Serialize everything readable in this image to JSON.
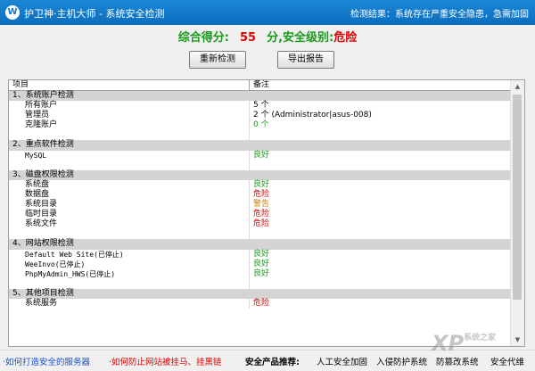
{
  "window": {
    "title": "护卫神·主机大师 - 系统安全检测",
    "logo_glyph": "W",
    "status": "检测结果：系统存在严重安全隐患，急需加固"
  },
  "score": {
    "label": "综合得分:",
    "value": "55",
    "unit": "分,",
    "level_label": "安全级别:",
    "level": "危险"
  },
  "buttons": {
    "recheck": "重新检测",
    "export": "导出报告"
  },
  "table": {
    "headers": [
      "项目",
      "备注"
    ],
    "groups": [
      {
        "title": "1、系统账户检测",
        "items": [
          {
            "name": "所有账户",
            "note": "5 个",
            "status": "normal"
          },
          {
            "name": "管理员",
            "note": "2 个 (Administrator|asus-008)",
            "status": "normal"
          },
          {
            "name": "克隆账户",
            "note": "0 个",
            "status": "good"
          }
        ]
      },
      {
        "title": "2、重点软件检测",
        "items": [
          {
            "name": "MySQL",
            "note": "良好",
            "status": "good"
          }
        ]
      },
      {
        "title": "3、磁盘权限检测",
        "items": [
          {
            "name": "系统盘",
            "note": "良好",
            "status": "good"
          },
          {
            "name": "数据盘",
            "note": "危险",
            "status": "danger"
          },
          {
            "name": "系统目录",
            "note": "警告",
            "status": "warning"
          },
          {
            "name": "临时目录",
            "note": "危险",
            "status": "danger"
          },
          {
            "name": "系统文件",
            "note": "危险",
            "status": "danger"
          }
        ]
      },
      {
        "title": "4、网站权限检测",
        "items": [
          {
            "name": "Default Web Site(已停止)",
            "note": "良好",
            "status": "good"
          },
          {
            "name": "WeeInvo(已停止)",
            "note": "良好",
            "status": "good"
          },
          {
            "name": "PhpMyAdmin_HWS(已停止)",
            "note": "良好",
            "status": "good"
          }
        ]
      },
      {
        "title": "5、其他项目检测",
        "items": [
          {
            "name": "系统服务",
            "note": "危险",
            "status": "danger"
          }
        ]
      }
    ]
  },
  "footer": {
    "link1": "·如何打造安全的服务器",
    "link2": "·如何防止网站被挂马、挂黑链",
    "products_label": "安全产品推荐:",
    "products": [
      "人工安全加固",
      "入侵防护系统",
      "防篡改系统",
      "安全代维"
    ]
  },
  "watermark": {
    "text": "XP",
    "sub": "系统之家"
  },
  "colors": {
    "good": "#1a9a1a",
    "danger": "#e00000",
    "warning": "#d08000",
    "title_bar": "#1278c8"
  }
}
